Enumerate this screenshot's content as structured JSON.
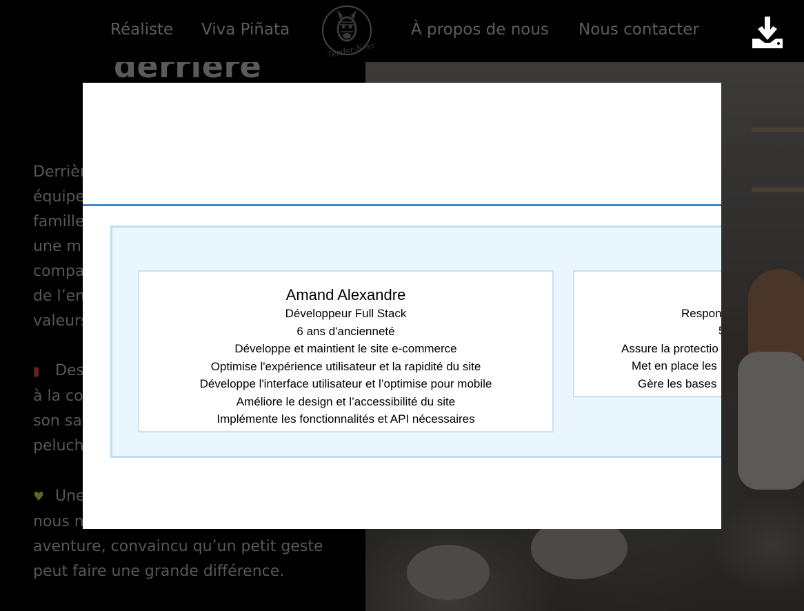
{
  "nav": {
    "links": [
      "Réaliste",
      "Viva Piñata",
      "À propos de nous",
      "Nous contacter"
    ],
    "logo_text": "Tender Ness",
    "download_icon": "download-icon"
  },
  "background": {
    "heading": "derrière",
    "intro_lines": [
      "Derrièr",
      "équipe",
      "famille",
      "une mi",
      "compa",
      "de l’en",
      "valeurs"
    ],
    "para2_emoji": "book-emoji",
    "para2_lines": [
      "Des",
      "à la co",
      "son sav",
      "peluch"
    ],
    "para3_emoji": "heart-emoji",
    "para3_lines": [
      "Une",
      "nous n",
      "aventure, convaincu qu’un petit geste",
      "peut faire une grande différence."
    ]
  },
  "modal": {
    "members": [
      {
        "name": "Amand Alexandre",
        "role": "Développeur Full Stack",
        "seniority": "6 ans d'ancienneté",
        "duties": [
          "Développe et maintient le site e-commerce",
          "Optimise l'expérience utilisateur et la rapidité du site",
          "Développe l'interface utilisateur et l’optimise pour mobile",
          "Améliore le design et l’accessibilité du site",
          "Implémente les fonctionnalités et API nécessaires"
        ]
      },
      {
        "role": "Respon",
        "seniority": "5",
        "duties": [
          "Assure la protectio",
          "Met en place les",
          "Gère les bases"
        ]
      }
    ]
  },
  "colors": {
    "modal_divider": "#3f88c9",
    "panel_bg": "#eaf6fd",
    "panel_border": "#bcdff0"
  }
}
